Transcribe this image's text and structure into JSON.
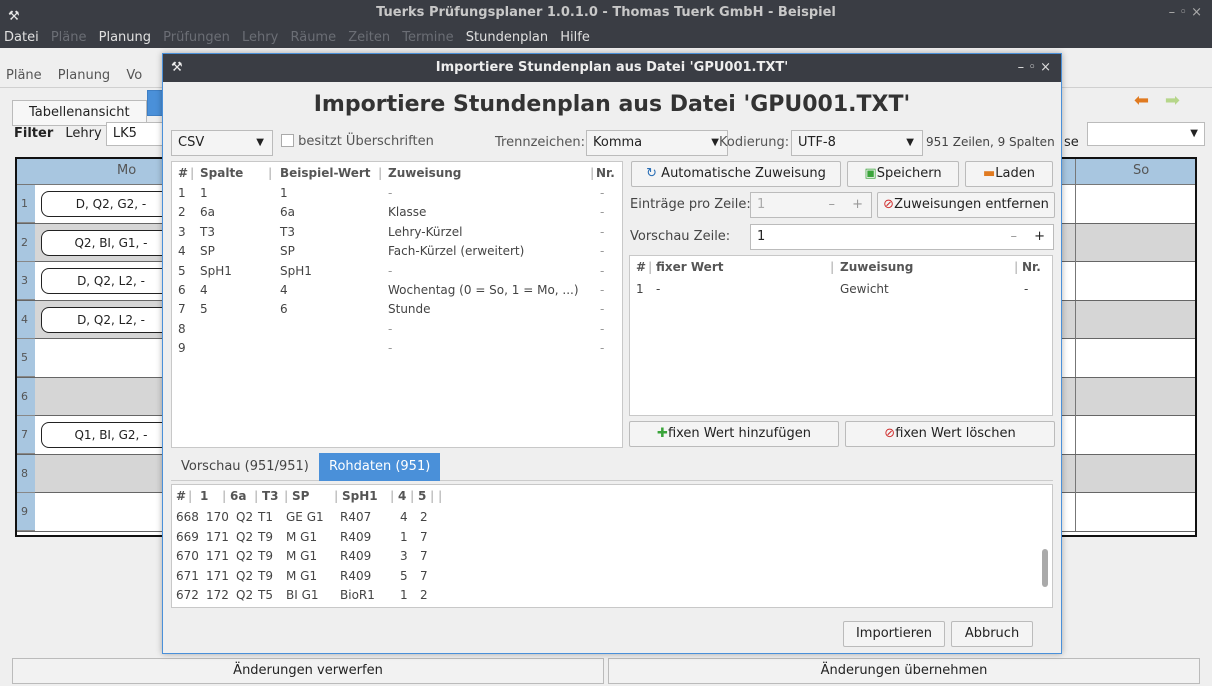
{
  "app": {
    "title": "Tuerks Prüfungsplaner 1.0.1.0 - Thomas Tuerk GmbH - Beispiel",
    "controls": "– ◦ ×"
  },
  "menu": [
    "Datei",
    "Pläne",
    "Planung",
    "Prüfungen",
    "Lehry",
    "Räume",
    "Zeiten",
    "Termine",
    "Stundenplan",
    "Hilfe"
  ],
  "submenu": [
    "Pläne",
    "Planung",
    "Vo"
  ],
  "tabs": {
    "t1": "Tabellenansicht",
    "t2": ""
  },
  "filter": {
    "label": "Filter",
    "lehry_label": "Lehry",
    "lehry_value": "LK5",
    "right_label": "se"
  },
  "grid": {
    "col_mo": "Mo",
    "col_so": "So",
    "rows": [
      {
        "n": "1",
        "mo": "D, Q2, G2, -"
      },
      {
        "n": "2",
        "mo": "Q2, BI, G1, -"
      },
      {
        "n": "3",
        "mo": "D, Q2, L2, -"
      },
      {
        "n": "4",
        "mo": "D, Q2, L2, -"
      },
      {
        "n": "5",
        "mo": ""
      },
      {
        "n": "6",
        "mo": ""
      },
      {
        "n": "7",
        "mo": "Q1, BI, G2, -"
      },
      {
        "n": "8",
        "mo": ""
      },
      {
        "n": "9",
        "mo": ""
      }
    ]
  },
  "bottom": {
    "discard": "Änderungen verwerfen",
    "apply": "Änderungen übernehmen"
  },
  "dialog": {
    "title": "Importiere Stundenplan aus Datei 'GPU001.TXT'",
    "controls": "– ◦ ×",
    "heading": "Importiere Stundenplan aus Datei 'GPU001.TXT'",
    "format": "CSV",
    "has_headers": "besitzt Überschriften",
    "sep_label": "Trennzeichen:",
    "sep_value": "Komma",
    "enc_label": "Kodierung:",
    "enc_value": "UTF-8",
    "info": "951 Zeilen, 9 Spalten",
    "mapping": {
      "headers": {
        "hash": "#",
        "spalte": "Spalte",
        "beispiel": "Beispiel-Wert",
        "zuweisung": "Zuweisung",
        "nr": "Nr."
      },
      "rows": [
        {
          "i": "1",
          "spalte": "1",
          "beispiel": "1",
          "zuweisung": "-",
          "nr": "-"
        },
        {
          "i": "2",
          "spalte": "6a",
          "beispiel": "6a",
          "zuweisung": "Klasse",
          "nr": "-"
        },
        {
          "i": "3",
          "spalte": "T3",
          "beispiel": "T3",
          "zuweisung": "Lehry-Kürzel",
          "nr": "-"
        },
        {
          "i": "4",
          "spalte": "SP",
          "beispiel": "SP",
          "zuweisung": "Fach-Kürzel (erweitert)",
          "nr": "-"
        },
        {
          "i": "5",
          "spalte": "SpH1",
          "beispiel": "SpH1",
          "zuweisung": "-",
          "nr": "-"
        },
        {
          "i": "6",
          "spalte": "4",
          "beispiel": "4",
          "zuweisung": "Wochentag (0 = So, 1 = Mo, ...)",
          "nr": "-"
        },
        {
          "i": "7",
          "spalte": "5",
          "beispiel": "6",
          "zuweisung": "Stunde",
          "nr": "-"
        },
        {
          "i": "8",
          "spalte": "",
          "beispiel": "",
          "zuweisung": "-",
          "nr": "-"
        },
        {
          "i": "9",
          "spalte": "",
          "beispiel": "",
          "zuweisung": "-",
          "nr": "-"
        }
      ]
    },
    "auto_btn": "Automatische Zuweisung",
    "save_btn": "Speichern",
    "load_btn": "Laden",
    "entries_label": "Einträge pro Zeile:",
    "entries_value": "1",
    "remove_btn": "Zuweisungen entfernen",
    "preview_label": "Vorschau Zeile:",
    "preview_value": "1",
    "fixed": {
      "headers": {
        "hash": "#",
        "wert": "fixer Wert",
        "zuweisung": "Zuweisung",
        "nr": "Nr."
      },
      "rows": [
        {
          "i": "1",
          "wert": "-",
          "zuweisung": "Gewicht",
          "nr": "-"
        }
      ]
    },
    "add_fixed_btn": "fixen Wert hinzufügen",
    "del_fixed_btn": "fixen Wert löschen",
    "tab_preview": "Vorschau (951/951)",
    "tab_raw": "Rohdaten (951)",
    "raw": {
      "headers": [
        "#",
        "1",
        "6a",
        "T3",
        "SP",
        "SpH1",
        "4",
        "5",
        ""
      ],
      "rows": [
        [
          "668",
          "170",
          "Q2",
          "T1",
          "GE G1",
          "R407",
          "4",
          "2"
        ],
        [
          "669",
          "171",
          "Q2",
          "T9",
          "M G1",
          "R409",
          "1",
          "7"
        ],
        [
          "670",
          "171",
          "Q2",
          "T9",
          "M G1",
          "R409",
          "3",
          "7"
        ],
        [
          "671",
          "171",
          "Q2",
          "T9",
          "M G1",
          "R409",
          "5",
          "7"
        ],
        [
          "672",
          "172",
          "Q2",
          "T5",
          "BI G1",
          "BioR1",
          "1",
          "2"
        ]
      ]
    },
    "import_btn": "Importieren",
    "cancel_btn": "Abbruch"
  }
}
